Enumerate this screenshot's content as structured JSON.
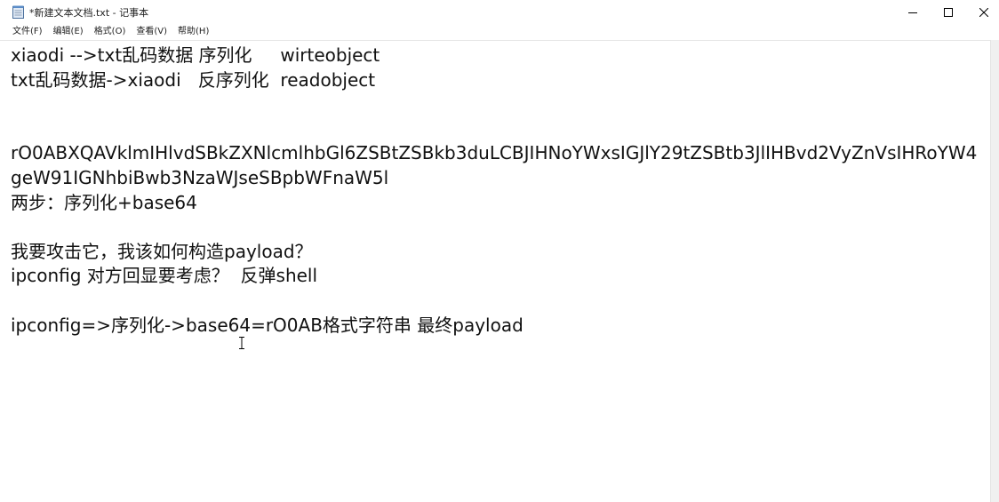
{
  "window": {
    "title": "*新建文本文档.txt - 记事本",
    "icon": "notepad-icon",
    "controls": {
      "minimize": "minimize-icon",
      "maximize": "maximize-icon",
      "close": "close-icon"
    }
  },
  "menu": {
    "items": [
      {
        "label": "文件(F)"
      },
      {
        "label": "编辑(E)"
      },
      {
        "label": "格式(O)"
      },
      {
        "label": "查看(V)"
      },
      {
        "label": "帮助(H)"
      }
    ]
  },
  "editor": {
    "lines": [
      "xiaodi -->txt乱码数据 序列化     wirteobject",
      "txt乱码数据->xiaodi   反序列化  readobject",
      "",
      "",
      "rO0ABXQAVklmIHlvdSBkZXNlcmlhbGl6ZSBtZSBkb3duLCBJIHNoYWxsIGJlY29tZSBtb3JlIHBvd2VyZnVsIHRoYW4geW91IGNhbiBwb3NzaWJseSBpbWFnaW5l",
      "两步：序列化+base64",
      "",
      "我要攻击它，我该如何构造payload？",
      "ipconfig 对方回显要考虑？  反弹shell",
      "",
      "ipconfig=>序列化->base64=rO0AB格式字符串 最终payload"
    ]
  }
}
